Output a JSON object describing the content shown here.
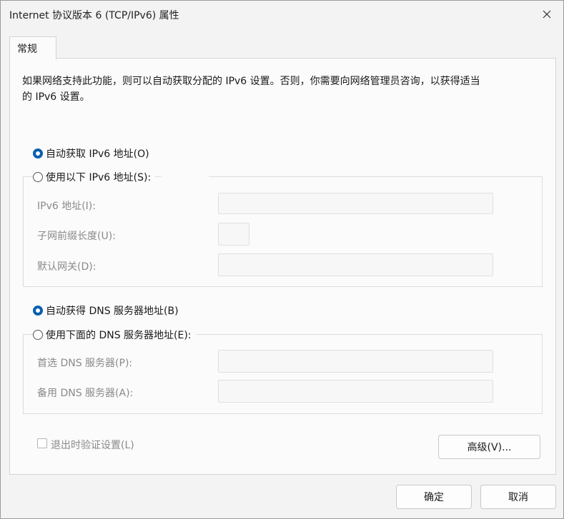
{
  "window": {
    "title": "Internet 协议版本 6 (TCP/IPv6) 属性",
    "close_icon": "close-icon"
  },
  "tabs": [
    {
      "label": "常规"
    }
  ],
  "description": {
    "line1": "如果网络支持此功能，则可以自动获取分配的 IPv6 设置。否则，你需要向网络管理员咨询，以获得适当",
    "line2": "的 IPv6 设置。"
  },
  "ip_section": {
    "auto_label": "自动获取 IPv6 地址(O)",
    "auto_selected": true,
    "manual_label": "使用以下 IPv6 地址(S):",
    "manual_selected": false,
    "fields": {
      "address_label": "IPv6 地址(I):",
      "address_value": "",
      "prefix_label": "子网前缀长度(U):",
      "prefix_value": "",
      "gateway_label": "默认网关(D):",
      "gateway_value": ""
    }
  },
  "dns_section": {
    "auto_label": "自动获得 DNS 服务器地址(B)",
    "auto_selected": true,
    "manual_label": "使用下面的 DNS 服务器地址(E):",
    "manual_selected": false,
    "fields": {
      "preferred_label": "首选 DNS 服务器(P):",
      "preferred_value": "",
      "alternate_label": "备用 DNS 服务器(A):",
      "alternate_value": ""
    }
  },
  "validate_on_exit": {
    "label": "退出时验证设置(L)",
    "checked": false
  },
  "buttons": {
    "advanced": "高级(V)...",
    "ok": "确定",
    "cancel": "取消"
  },
  "colors": {
    "accent": "#0a5fb0",
    "disabled_text": "#8a8a8a"
  }
}
